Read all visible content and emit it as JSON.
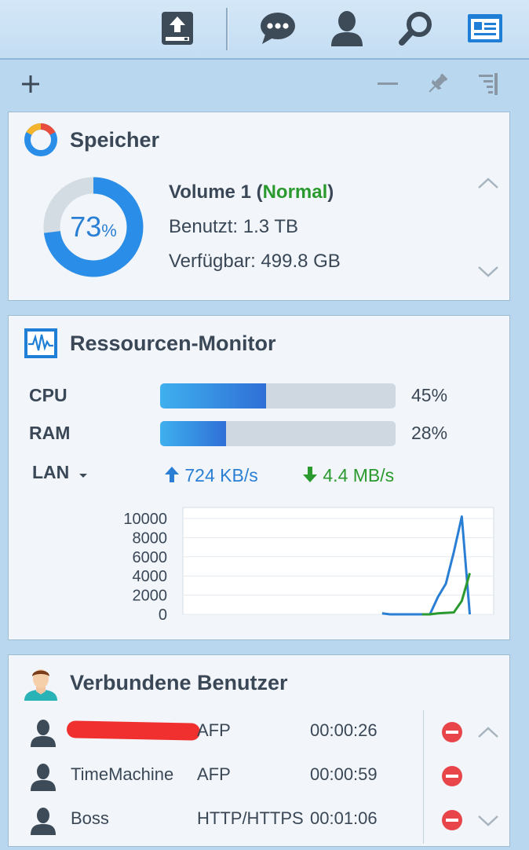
{
  "topbar": {
    "icons": [
      "upload-icon",
      "chat-icon",
      "user-icon",
      "search-icon",
      "widgets-icon"
    ]
  },
  "toolbar": {
    "icons": [
      "add-icon",
      "minimize-icon",
      "pin-icon",
      "panel-settings-icon"
    ]
  },
  "storage": {
    "title": "Speicher",
    "percent": "73",
    "percent_unit": "%",
    "volume_label": "Volume 1 (",
    "volume_status": "Normal",
    "volume_close": ")",
    "used": "Benutzt: 1.3 TB",
    "available": "Verfügbar: 499.8 GB",
    "used_fraction": 0.73,
    "colors": {
      "used": "#2a8ee8",
      "free": "#d3dbe3"
    }
  },
  "resource_monitor": {
    "title": "Ressourcen-Monitor",
    "cpu": {
      "label": "CPU",
      "value": "45%",
      "fraction": 0.45
    },
    "ram": {
      "label": "RAM",
      "value": "28%",
      "fraction": 0.28
    },
    "lan": {
      "label": "LAN",
      "upload": "724 KB/s",
      "download": "4.4 MB/s"
    },
    "colors": {
      "upload": "#2a7fd4",
      "download": "#2a9a2e"
    }
  },
  "chart_data": {
    "type": "line",
    "title": "",
    "xlabel": "",
    "ylabel": "",
    "y_ticks": [
      "10000",
      "8000",
      "6000",
      "4000",
      "2000",
      "0"
    ],
    "ylim": [
      0,
      10000
    ],
    "x": [
      0,
      1,
      2,
      3,
      4,
      5,
      6,
      7,
      8,
      9,
      10,
      11,
      12,
      13,
      14,
      15,
      16,
      17,
      18,
      19,
      20,
      21,
      22,
      23,
      24,
      25,
      26,
      27,
      28,
      29,
      30,
      31,
      32,
      33,
      34,
      35,
      36,
      37,
      38,
      39
    ],
    "series": [
      {
        "color": "#2a7fd4",
        "values": [
          null,
          null,
          null,
          null,
          null,
          null,
          null,
          null,
          null,
          null,
          null,
          null,
          null,
          null,
          null,
          null,
          null,
          null,
          null,
          null,
          null,
          null,
          null,
          null,
          null,
          100,
          0,
          0,
          0,
          0,
          0,
          0,
          1800,
          3200,
          6500,
          10200,
          0
        ]
      },
      {
        "color": "#2a9a2e",
        "values": [
          null,
          null,
          null,
          null,
          null,
          null,
          null,
          null,
          null,
          null,
          null,
          null,
          null,
          null,
          null,
          null,
          null,
          null,
          null,
          null,
          null,
          null,
          null,
          null,
          null,
          null,
          null,
          null,
          null,
          null,
          0,
          0,
          100,
          150,
          200,
          1400,
          4300
        ]
      }
    ],
    "grid": true
  },
  "connected_users": {
    "title": "Verbundene Benutzer",
    "rows": [
      {
        "name": "",
        "protocol": "AFP",
        "duration": "00:00:26"
      },
      {
        "name": "TimeMachine",
        "protocol": "AFP",
        "duration": "00:00:59"
      },
      {
        "name": "Boss",
        "protocol": "HTTP/HTTPS",
        "duration": "00:01:06"
      }
    ]
  }
}
